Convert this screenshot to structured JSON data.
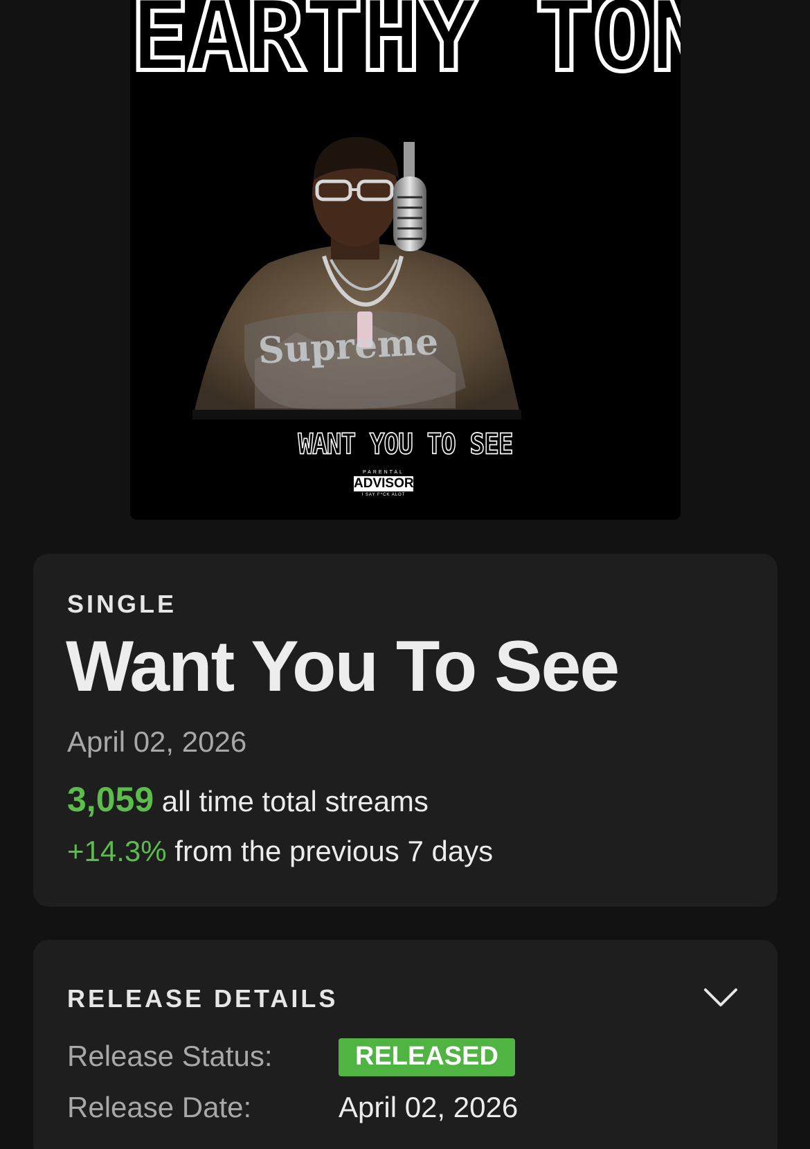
{
  "cover": {
    "artist_text": "EARTHY TONE",
    "track_text": "WANT YOU TO SEE",
    "shirt_text": "Supreme",
    "advisory": {
      "top": "PARENTAL",
      "main": "ADVISORY",
      "bottom": "I SAY F*CK ALOT"
    }
  },
  "release": {
    "type": "SINGLE",
    "title": "Want You To See",
    "date": "April 02, 2026",
    "streams_value": "3,059",
    "streams_label": "all time total streams",
    "change_value": "+14.3%",
    "change_label": "from the previous 7 days"
  },
  "details": {
    "heading": "RELEASE DETAILS",
    "expand_icon": "chevron-down-icon",
    "status_label": "Release Status:",
    "status_value": "RELEASED",
    "date_label": "Release Date:",
    "date_value": "April 02, 2026"
  },
  "colors": {
    "background": "#121212",
    "card": "#1e1e1e",
    "accent_green": "#5cbc4c",
    "badge_green": "#50b442",
    "muted_text": "#a8a8a8",
    "primary_text": "#ececec"
  }
}
